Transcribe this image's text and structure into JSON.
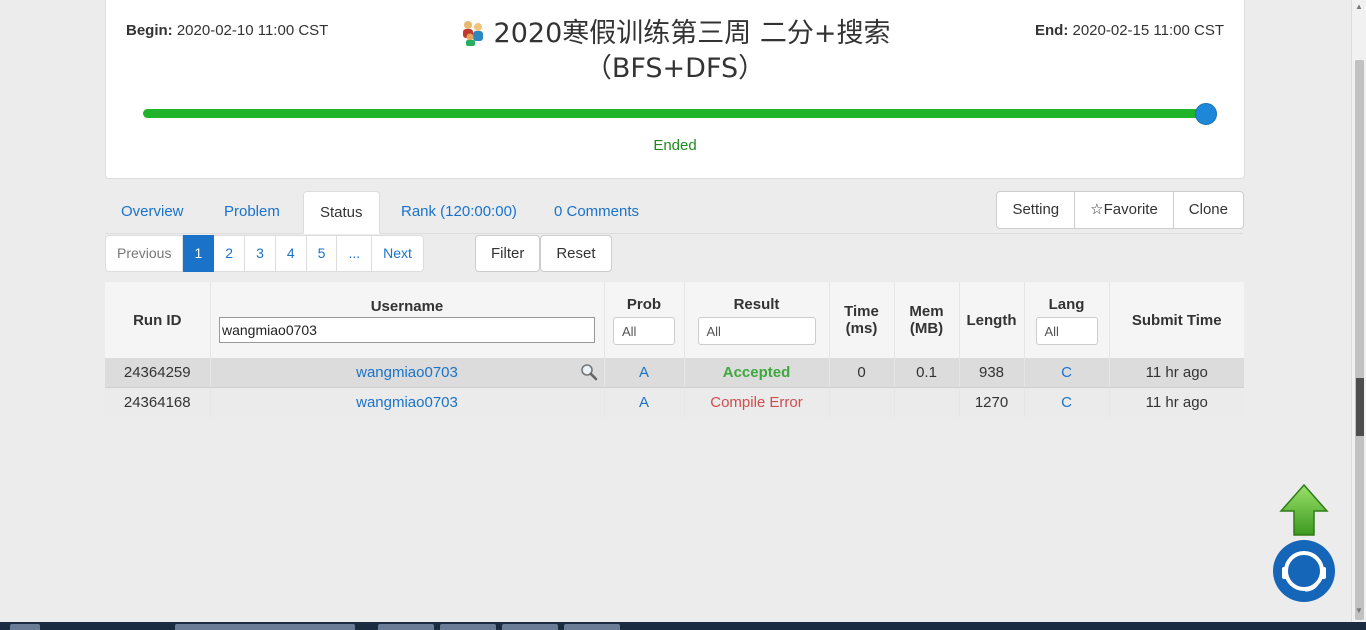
{
  "contest": {
    "begin_label": "Begin:",
    "begin_value": "2020-02-10 11:00 CST",
    "end_label": "End:",
    "end_value": "2020-02-15 11:00 CST",
    "title_line1": "2020寒假训练第三周 二分+搜索",
    "title_line2": "（BFS+DFS）",
    "progress_fraction": 1.0,
    "status": "Ended"
  },
  "tabs": [
    {
      "label": "Overview"
    },
    {
      "label": "Problem"
    },
    {
      "label": "Status"
    },
    {
      "label": "Rank (120:00:00)"
    },
    {
      "label": "0 Comments"
    }
  ],
  "actions": {
    "setting": "Setting",
    "favorite": "☆Favorite",
    "clone": "Clone"
  },
  "pager": {
    "previous": "Previous",
    "pages": [
      "1",
      "2",
      "3",
      "4",
      "5",
      "..."
    ],
    "next": "Next",
    "current": "1"
  },
  "filter": {
    "filter": "Filter",
    "reset": "Reset"
  },
  "table": {
    "headers": {
      "run_id": "Run ID",
      "username": "Username",
      "prob": "Prob",
      "result": "Result",
      "time_l1": "Time",
      "time_l2": "(ms)",
      "mem_l1": "Mem",
      "mem_l2": "(MB)",
      "length": "Length",
      "lang": "Lang",
      "submit_time": "Submit Time"
    },
    "username_filter": "wangmiao0703",
    "prob_filter": "All",
    "result_filter": "All",
    "lang_filter": "All",
    "rows": [
      {
        "run_id": "24364259",
        "username": "wangmiao0703",
        "prob": "A",
        "result": "Accepted",
        "time": "0",
        "mem": "0.1",
        "length": "938",
        "lang": "C",
        "submit_time": "11 hr ago"
      },
      {
        "run_id": "24364168",
        "username": "wangmiao0703",
        "prob": "A",
        "result": "Compile Error",
        "time": "",
        "mem": "",
        "length": "1270",
        "lang": "C",
        "submit_time": "11 hr ago"
      }
    ]
  },
  "colors": {
    "accent": "#1a73c9",
    "progress": "#20b42a",
    "accepted": "#3ea83e",
    "compile_error": "#d24d4d"
  }
}
